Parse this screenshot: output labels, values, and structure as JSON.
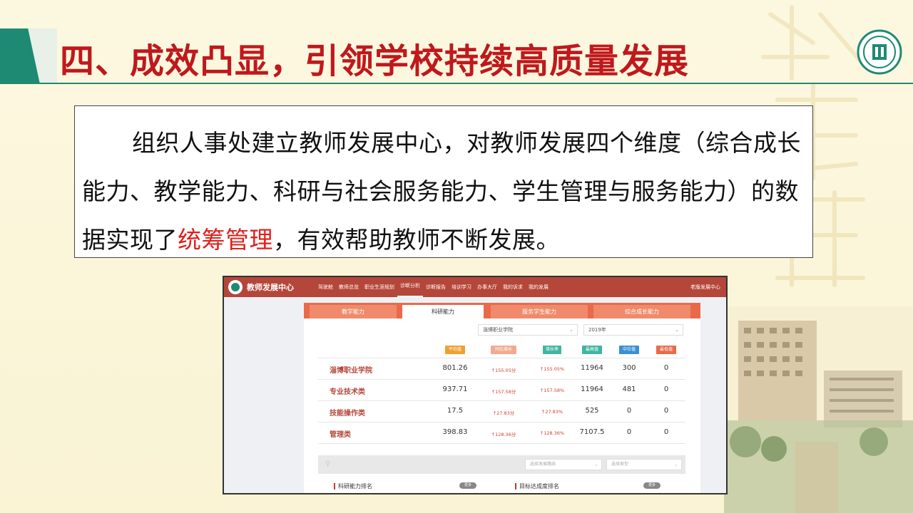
{
  "slide": {
    "title": "四、成效凸显，引领学校持续高质量发展",
    "paragraph_before": "组织人事处建立教师发展中心，对教师发展四个维度（综合成长能力、教学能力、科研与社会服务能力、学生管理与服务能力）的数据实现了",
    "paragraph_highlight": "统筹管理",
    "paragraph_after": "，有效帮助教师不断发展。",
    "colors": {
      "title": "#c0181c",
      "accent": "#1f8a74",
      "highlight": "#e0201c"
    }
  },
  "app": {
    "brand": "教师发展中心",
    "nav": [
      "驾驶舱",
      "教师总览",
      "职业生涯规划",
      "诊断分析",
      "诊断报告",
      "培训学习",
      "办事大厅",
      "我的诉求",
      "我的发展"
    ],
    "active_nav": "诊断分析",
    "right_link": "老版发展中心",
    "tabs": [
      "教学能力",
      "科研能力",
      "服务学生能力",
      "综合成长能力"
    ],
    "active_tab": "科研能力",
    "school_select": "淄博职业学院",
    "year_select": "2019年",
    "headers": [
      "平均值",
      "同比增长",
      "增长率",
      "最高值",
      "中位值",
      "最低值"
    ],
    "header_colors": [
      "#f0a030",
      "#f08a6a",
      "#3fb6a0",
      "#3fb6a0",
      "#3a8fd6",
      "#e86a4a"
    ],
    "rows": [
      {
        "name": "淄博职业学院",
        "avg": "801.26",
        "yoy": "↑155.05分",
        "rate": "↑155.05%",
        "max": "11964",
        "median": "300",
        "min": "0"
      },
      {
        "name": "专业技术类",
        "avg": "937.71",
        "yoy": "↑157.58分",
        "rate": "↑157.58%",
        "max": "11964",
        "median": "481",
        "min": "0"
      },
      {
        "name": "技能操作类",
        "avg": "17.5",
        "yoy": "↑27.83分",
        "rate": "↑27.83%",
        "max": "525",
        "median": "0",
        "min": "0"
      },
      {
        "name": "管理类",
        "avg": "398.83",
        "yoy": "↑128.36分",
        "rate": "↑128.36%",
        "max": "7107.5",
        "median": "0",
        "min": "0"
      }
    ],
    "filter_direction_placeholder": "选择发展路线",
    "filter_type_placeholder": "选择类型",
    "ranking_left": "科研能力排名",
    "ranking_right": "目标达成度排名",
    "more_label": "更多"
  }
}
